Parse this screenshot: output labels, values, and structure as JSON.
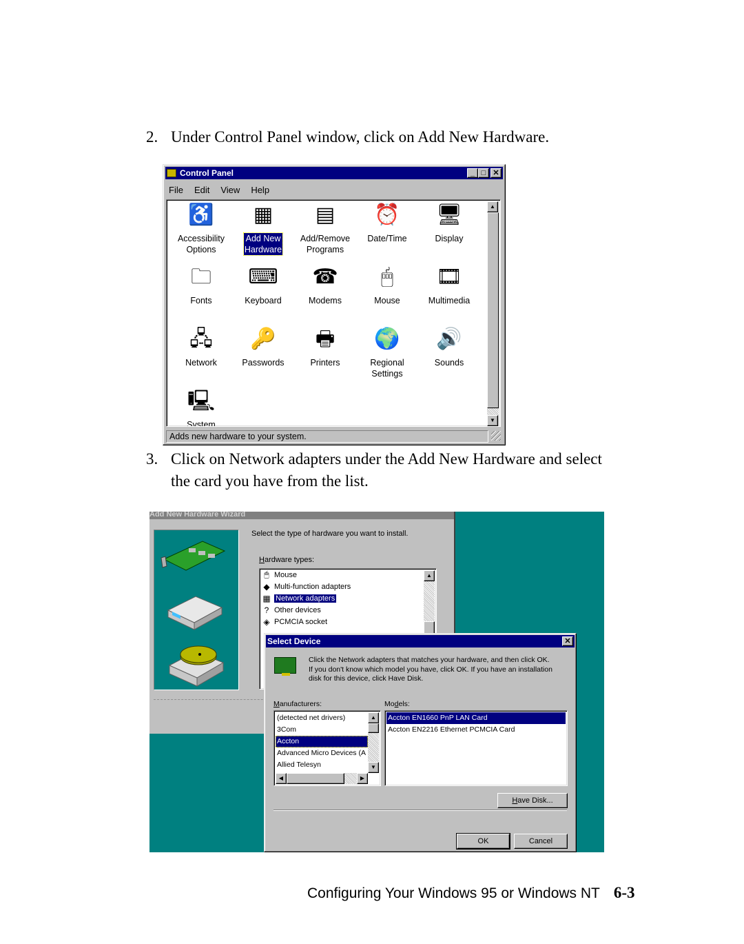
{
  "steps": [
    {
      "number": "2.",
      "text": "Under Control Panel window, click on Add New Hardware."
    },
    {
      "number": "3.",
      "line1": "Click on Network adapters under the Add New Hardware and select",
      "line2": "the card you have from the list."
    }
  ],
  "control_panel": {
    "title": "Control Panel",
    "window_buttons": {
      "minimize": "_",
      "maximize": "□",
      "close": "✕"
    },
    "menu": [
      "File",
      "Edit",
      "View",
      "Help"
    ],
    "icons": [
      {
        "label1": "Accessibility",
        "label2": "Options",
        "icon": "accessibility-icon",
        "glyph": "♿"
      },
      {
        "label1": "Add New",
        "label2": "Hardware",
        "icon": "add-new-hardware-icon",
        "glyph": "▦",
        "selected": true
      },
      {
        "label1": "Add/Remove",
        "label2": "Programs",
        "icon": "add-remove-programs-icon",
        "glyph": "▤"
      },
      {
        "label1": "Date/Time",
        "label2": "",
        "icon": "date-time-icon",
        "glyph": "⏰"
      },
      {
        "label1": "Display",
        "label2": "",
        "icon": "display-icon",
        "glyph": "🖥"
      },
      {
        "label1": "Fonts",
        "label2": "",
        "icon": "fonts-icon",
        "glyph": "🗀"
      },
      {
        "label1": "Keyboard",
        "label2": "",
        "icon": "keyboard-icon",
        "glyph": "⌨"
      },
      {
        "label1": "Modems",
        "label2": "",
        "icon": "modems-icon",
        "glyph": "☎"
      },
      {
        "label1": "Mouse",
        "label2": "",
        "icon": "mouse-icon",
        "glyph": "🖱"
      },
      {
        "label1": "Multimedia",
        "label2": "",
        "icon": "multimedia-icon",
        "glyph": "🎞"
      },
      {
        "label1": "Network",
        "label2": "",
        "icon": "network-icon",
        "glyph": "🖧"
      },
      {
        "label1": "Passwords",
        "label2": "",
        "icon": "passwords-icon",
        "glyph": "🔑"
      },
      {
        "label1": "Printers",
        "label2": "",
        "icon": "printers-icon",
        "glyph": "🖶"
      },
      {
        "label1": "Regional",
        "label2": "Settings",
        "icon": "regional-settings-icon",
        "glyph": "🌍"
      },
      {
        "label1": "Sounds",
        "label2": "",
        "icon": "sounds-icon",
        "glyph": "🔊"
      },
      {
        "label1": "System",
        "label2": "",
        "icon": "system-icon",
        "glyph": "🖳"
      }
    ],
    "status_text": "Adds new hardware to your system."
  },
  "wizard": {
    "title": "Add New Hardware Wizard",
    "prompt": "Select the type of hardware you want to install.",
    "hardware_types_label": "Hardware types:",
    "hardware_types": [
      {
        "label": "Mouse",
        "glyph": "🖱"
      },
      {
        "label": "Multi-function adapters",
        "glyph": "◆"
      },
      {
        "label": "Network adapters",
        "glyph": "▦",
        "selected": true
      },
      {
        "label": "Other devices",
        "glyph": "?"
      },
      {
        "label": "PCMCIA socket",
        "glyph": "◈"
      }
    ]
  },
  "select_device": {
    "title": "Select Device",
    "close": "✕",
    "message_line1": "Click the Network adapters that matches your hardware, and then click OK.",
    "message_line2": "If you don't know which model you have, click OK. If you have an installation",
    "message_line3": "disk for this device, click Have Disk.",
    "manufacturers_label": "Manufacturers:",
    "manufacturers": [
      "(detected net drivers)",
      "3Com",
      "Accton",
      "Advanced Micro Devices (A",
      "Allied Telesyn"
    ],
    "selected_manufacturer_index": 2,
    "models_label": "Models:",
    "models": [
      "Accton EN1660 PnP LAN Card",
      "Accton EN2216 Ethernet PCMCIA Card"
    ],
    "selected_model_index": 0,
    "have_disk_label": "Have Disk...",
    "ok_label": "OK",
    "cancel_label": "Cancel"
  },
  "footer": {
    "title": "Configuring Your Windows 95 or Windows NT",
    "page": "6-3"
  }
}
